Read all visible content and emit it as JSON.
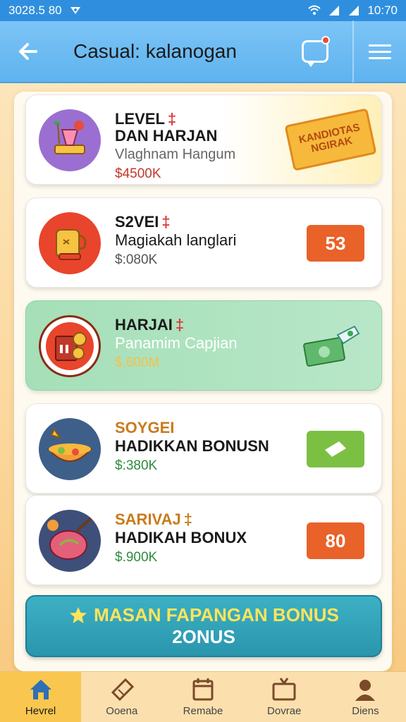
{
  "status_bar": {
    "left_text": "3028.5 80",
    "time": "10:70"
  },
  "header": {
    "title": "Casual: kalanogan"
  },
  "cards": [
    {
      "title": "LEVEL",
      "title_mark": "‡",
      "title2": "DAN HARJAN",
      "subtitle": "Vlaghnam Hangum",
      "price": "$4500K",
      "stamp": "KANDIOTAS NGIRAK",
      "icon": "cocktail-icon"
    },
    {
      "title": "S2VEI",
      "title_mark": "‡",
      "subtitle": "Magiakah langlari",
      "price": "$:080K",
      "badge": "53",
      "icon": "teapot-icon"
    },
    {
      "title": "HARJAI",
      "title_mark": "‡",
      "subtitle": "Panamim Capjian",
      "price": "$.600M",
      "icon": "coin-jar-icon"
    },
    {
      "title": "SOYGEI",
      "subtitle": "HADIKKAN BONUSN",
      "price": "$:380K",
      "icon": "food-bowl-icon"
    },
    {
      "title": "SARIVAJ",
      "title_mark": "‡",
      "subtitle": "HADIKAH BONUX",
      "price": "$.900K",
      "badge": "80",
      "icon": "meat-icon"
    }
  ],
  "cta": {
    "line1": "MASAN FAPANGAN BONUS",
    "line2": "2ONUS"
  },
  "nav": [
    {
      "label": "Hevrel",
      "icon": "home-icon"
    },
    {
      "label": "Ooena",
      "icon": "ticket-icon"
    },
    {
      "label": "Remabe",
      "icon": "calendar-icon"
    },
    {
      "label": "Dovrae",
      "icon": "tv-icon"
    },
    {
      "label": "Diens",
      "icon": "profile-icon"
    }
  ],
  "colors": {
    "app_bar": "#5fb3ef",
    "status_bar": "#2f8fde",
    "badge_orange": "#e8622a",
    "badge_green": "#7bc043",
    "cta": "#2a96ad",
    "nav_active": "#f9c74f"
  }
}
